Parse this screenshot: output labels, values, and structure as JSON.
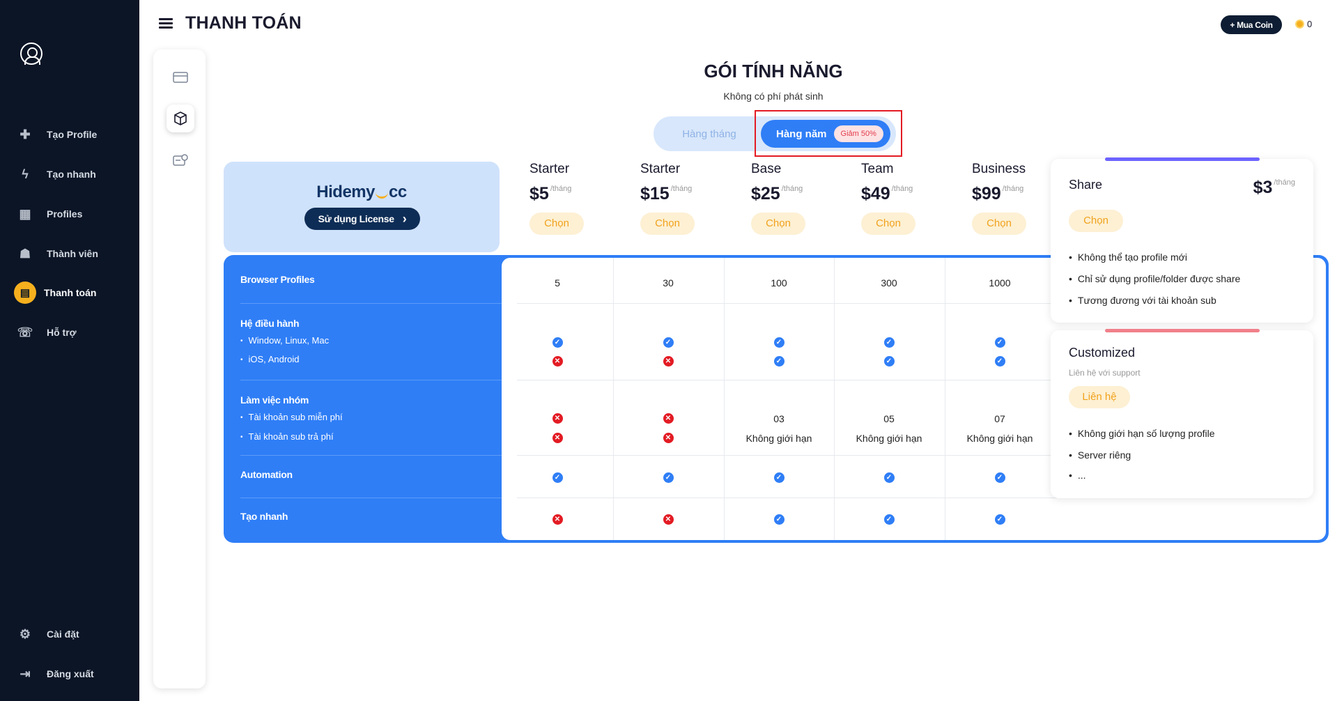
{
  "sidebar": {
    "items": [
      {
        "label": "Tạo Profile",
        "icon": "plus-icon"
      },
      {
        "label": "Tạo nhanh",
        "icon": "lightning-icon"
      },
      {
        "label": "Profiles",
        "icon": "grid-icon"
      },
      {
        "label": "Thành viên",
        "icon": "team-icon"
      },
      {
        "label": "Thanh toán",
        "icon": "payment-icon"
      },
      {
        "label": "Hỗ trợ",
        "icon": "support-icon"
      }
    ],
    "bottom": [
      {
        "label": "Cài đặt",
        "icon": "gear-icon"
      },
      {
        "label": "Đăng xuất",
        "icon": "logout-icon"
      }
    ],
    "active": "Thanh toán"
  },
  "header": {
    "title": "THANH TOÁN",
    "buy_coin": "+ Mua Coin",
    "coin_balance": "0"
  },
  "plans": {
    "title": "GÓI TÍNH NĂNG",
    "subtitle": "Không có phí phát sinh",
    "toggle": {
      "monthly": "Hàng tháng",
      "yearly": "Hàng năm",
      "discount": "Giảm 50%",
      "selected": "yearly"
    },
    "brand": {
      "logo_left": "Hidemy",
      "logo_right": "cc",
      "license_button": "Sử dụng License"
    },
    "price_unit": "/tháng",
    "choose_label": "Chọn",
    "columns": [
      {
        "name": "Starter",
        "price": "$5"
      },
      {
        "name": "Starter",
        "price": "$15"
      },
      {
        "name": "Base",
        "price": "$25"
      },
      {
        "name": "Team",
        "price": "$49"
      },
      {
        "name": "Business",
        "price": "$99"
      }
    ],
    "features": {
      "browser_profiles": {
        "label": "Browser Profiles",
        "values": [
          "5",
          "30",
          "100",
          "300",
          "1000"
        ]
      },
      "os": {
        "label": "Hệ điều hành",
        "sub": [
          "Window, Linux, Mac",
          "iOS, Android"
        ]
      },
      "team": {
        "label": "Làm việc nhóm",
        "sub": [
          "Tài khoản sub miễn phí",
          "Tài khoản sub trả phí"
        ],
        "values_free": [
          "03",
          "05",
          "07"
        ],
        "values_paid": [
          "Không giới hạn",
          "Không giới hạn",
          "Không giới hạn"
        ]
      },
      "automation": {
        "label": "Automation"
      },
      "quick_create": {
        "label": "Tạo nhanh"
      }
    },
    "share_card": {
      "title": "Share",
      "price": "$3",
      "unit": "/tháng",
      "button": "Chọn",
      "bullets": [
        "Không thể tạo profile mới",
        "Chỉ sử dụng profile/folder được share",
        "Tương đương với tài khoản sub"
      ],
      "accent": "#6c63ff"
    },
    "custom_card": {
      "title": "Customized",
      "note": "Liên hệ với support",
      "button": "Liên hệ",
      "bullets": [
        "Không giới hạn số lượng profile",
        "Server riêng",
        "..."
      ],
      "accent": "#f0808a"
    }
  },
  "colors": {
    "sidebar_bg": "#0b1526",
    "primary": "#2f7ef6",
    "accent_yellow": "#f6b01e",
    "check": "#2f7ef6",
    "cross": "#e31b23"
  }
}
